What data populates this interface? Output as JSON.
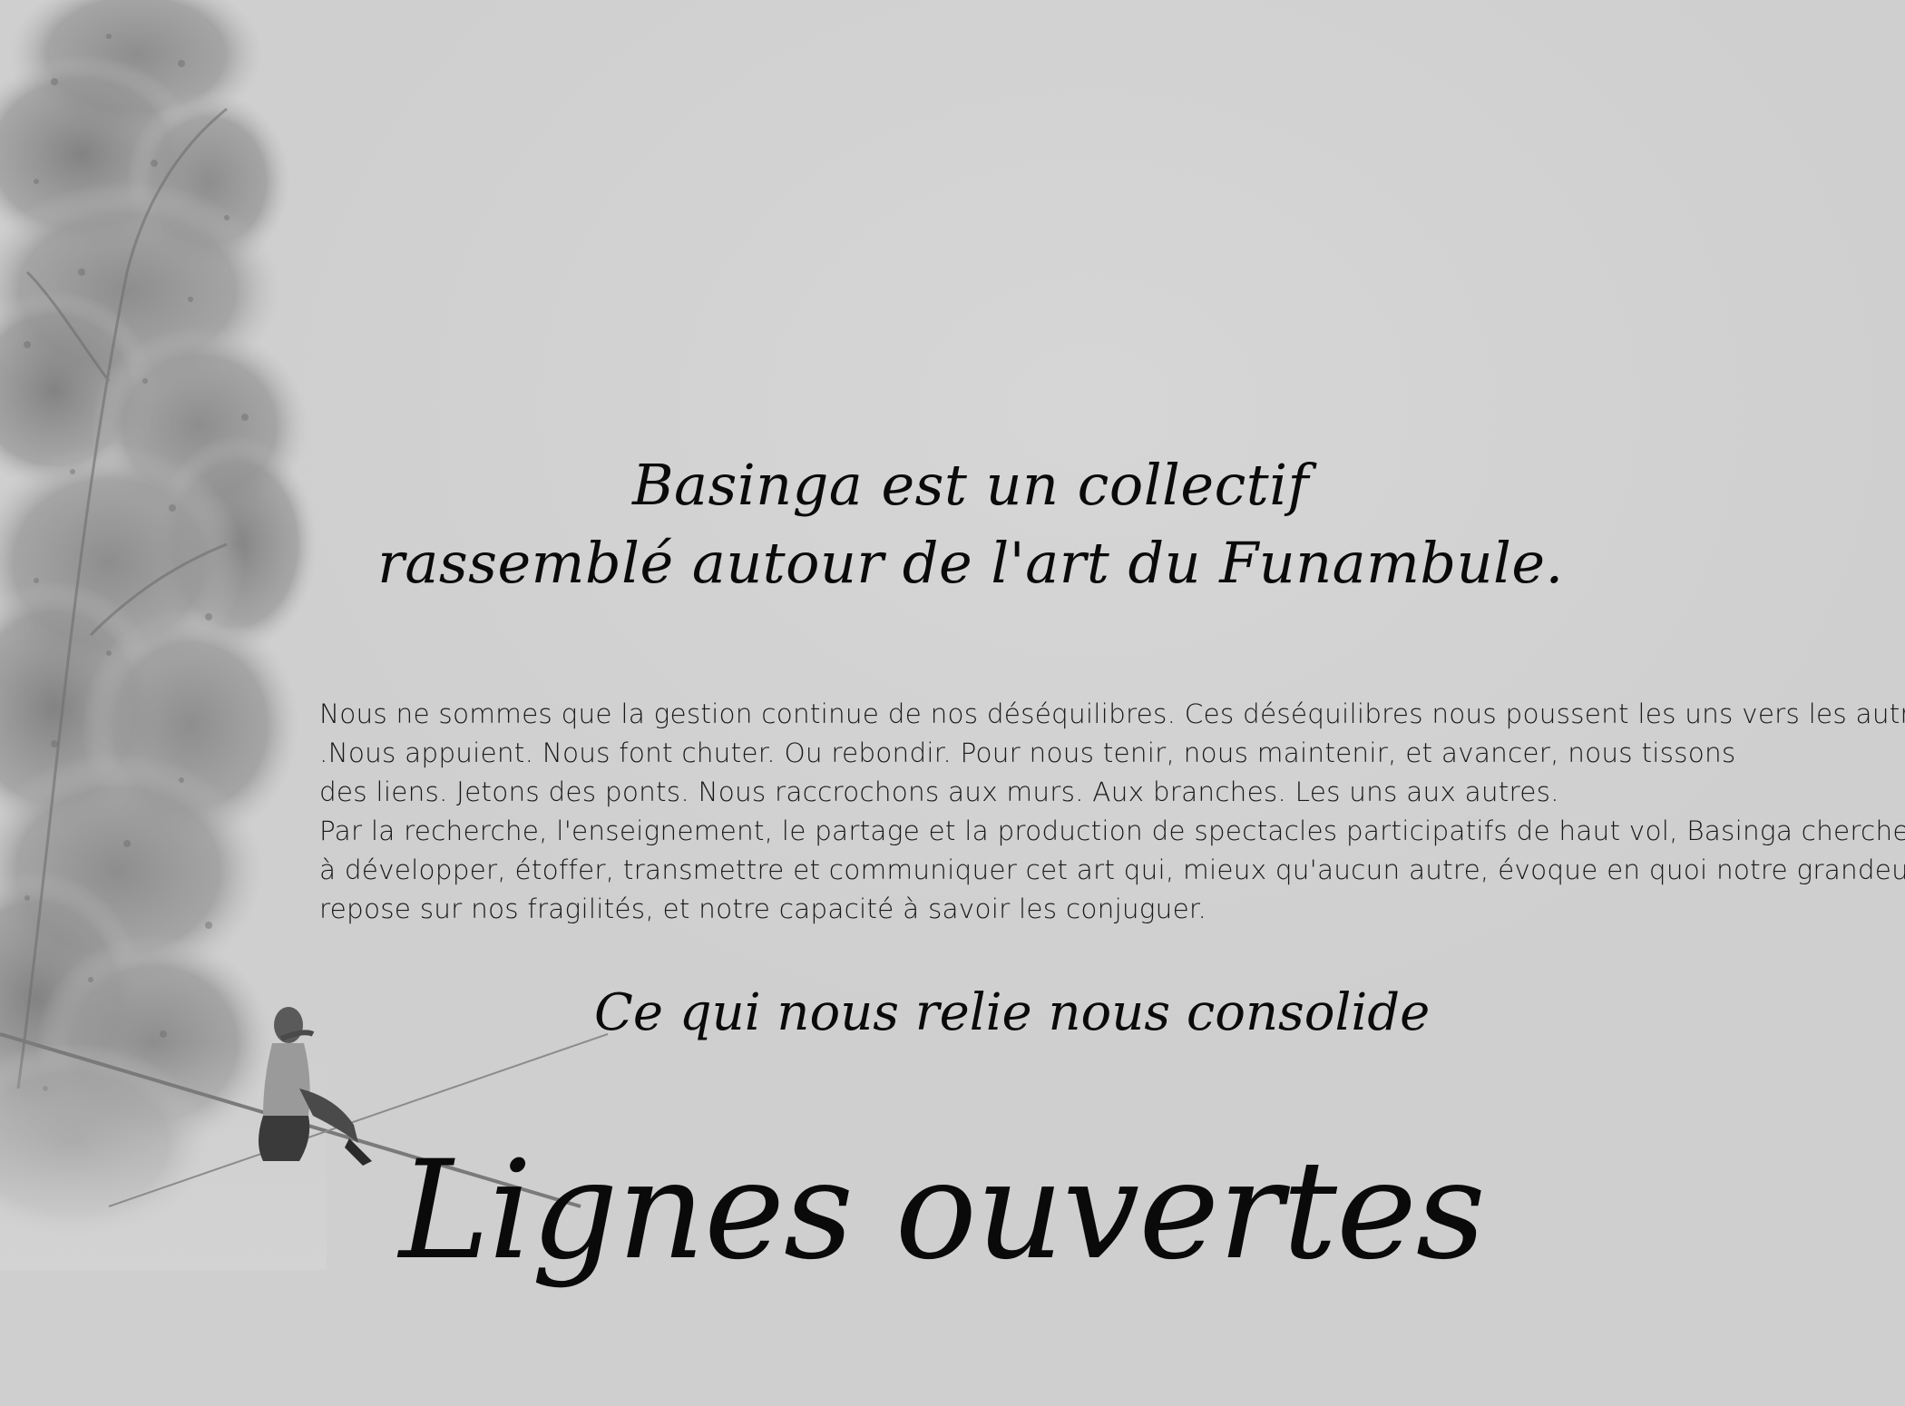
{
  "tagline": {
    "line1": "Basinga est un collectif",
    "line2": "rassemblé autour de l'art du Funambule."
  },
  "body": {
    "lines": [
      "Nous ne sommes que la gestion continue de nos déséquilibres. Ces déséquilibres nous poussent les uns vers les autres",
      ".Nous appuient. Nous font chuter. Ou rebondir. Pour nous tenir, nous maintenir, et avancer, nous tissons",
      "des liens. Jetons des ponts. Nous raccrochons aux murs. Aux branches. Les uns aux autres.",
      "Par la recherche, l'enseignement, le partage et la production de spectacles participatifs de haut vol, Basinga cherche",
      "à développer, étoffer, transmettre et communiquer cet art qui, mieux qu'aucun autre, évoque en quoi notre grandeur",
      "repose sur nos fragilités, et notre capacité à savoir les conjuguer."
    ]
  },
  "motto": "Ce qui nous relie nous consolide",
  "title": "Lignes ouvertes",
  "colors": {
    "background": "#d3d3d3",
    "text": "#0a0a0a",
    "foliage": "#8f8f8f"
  }
}
